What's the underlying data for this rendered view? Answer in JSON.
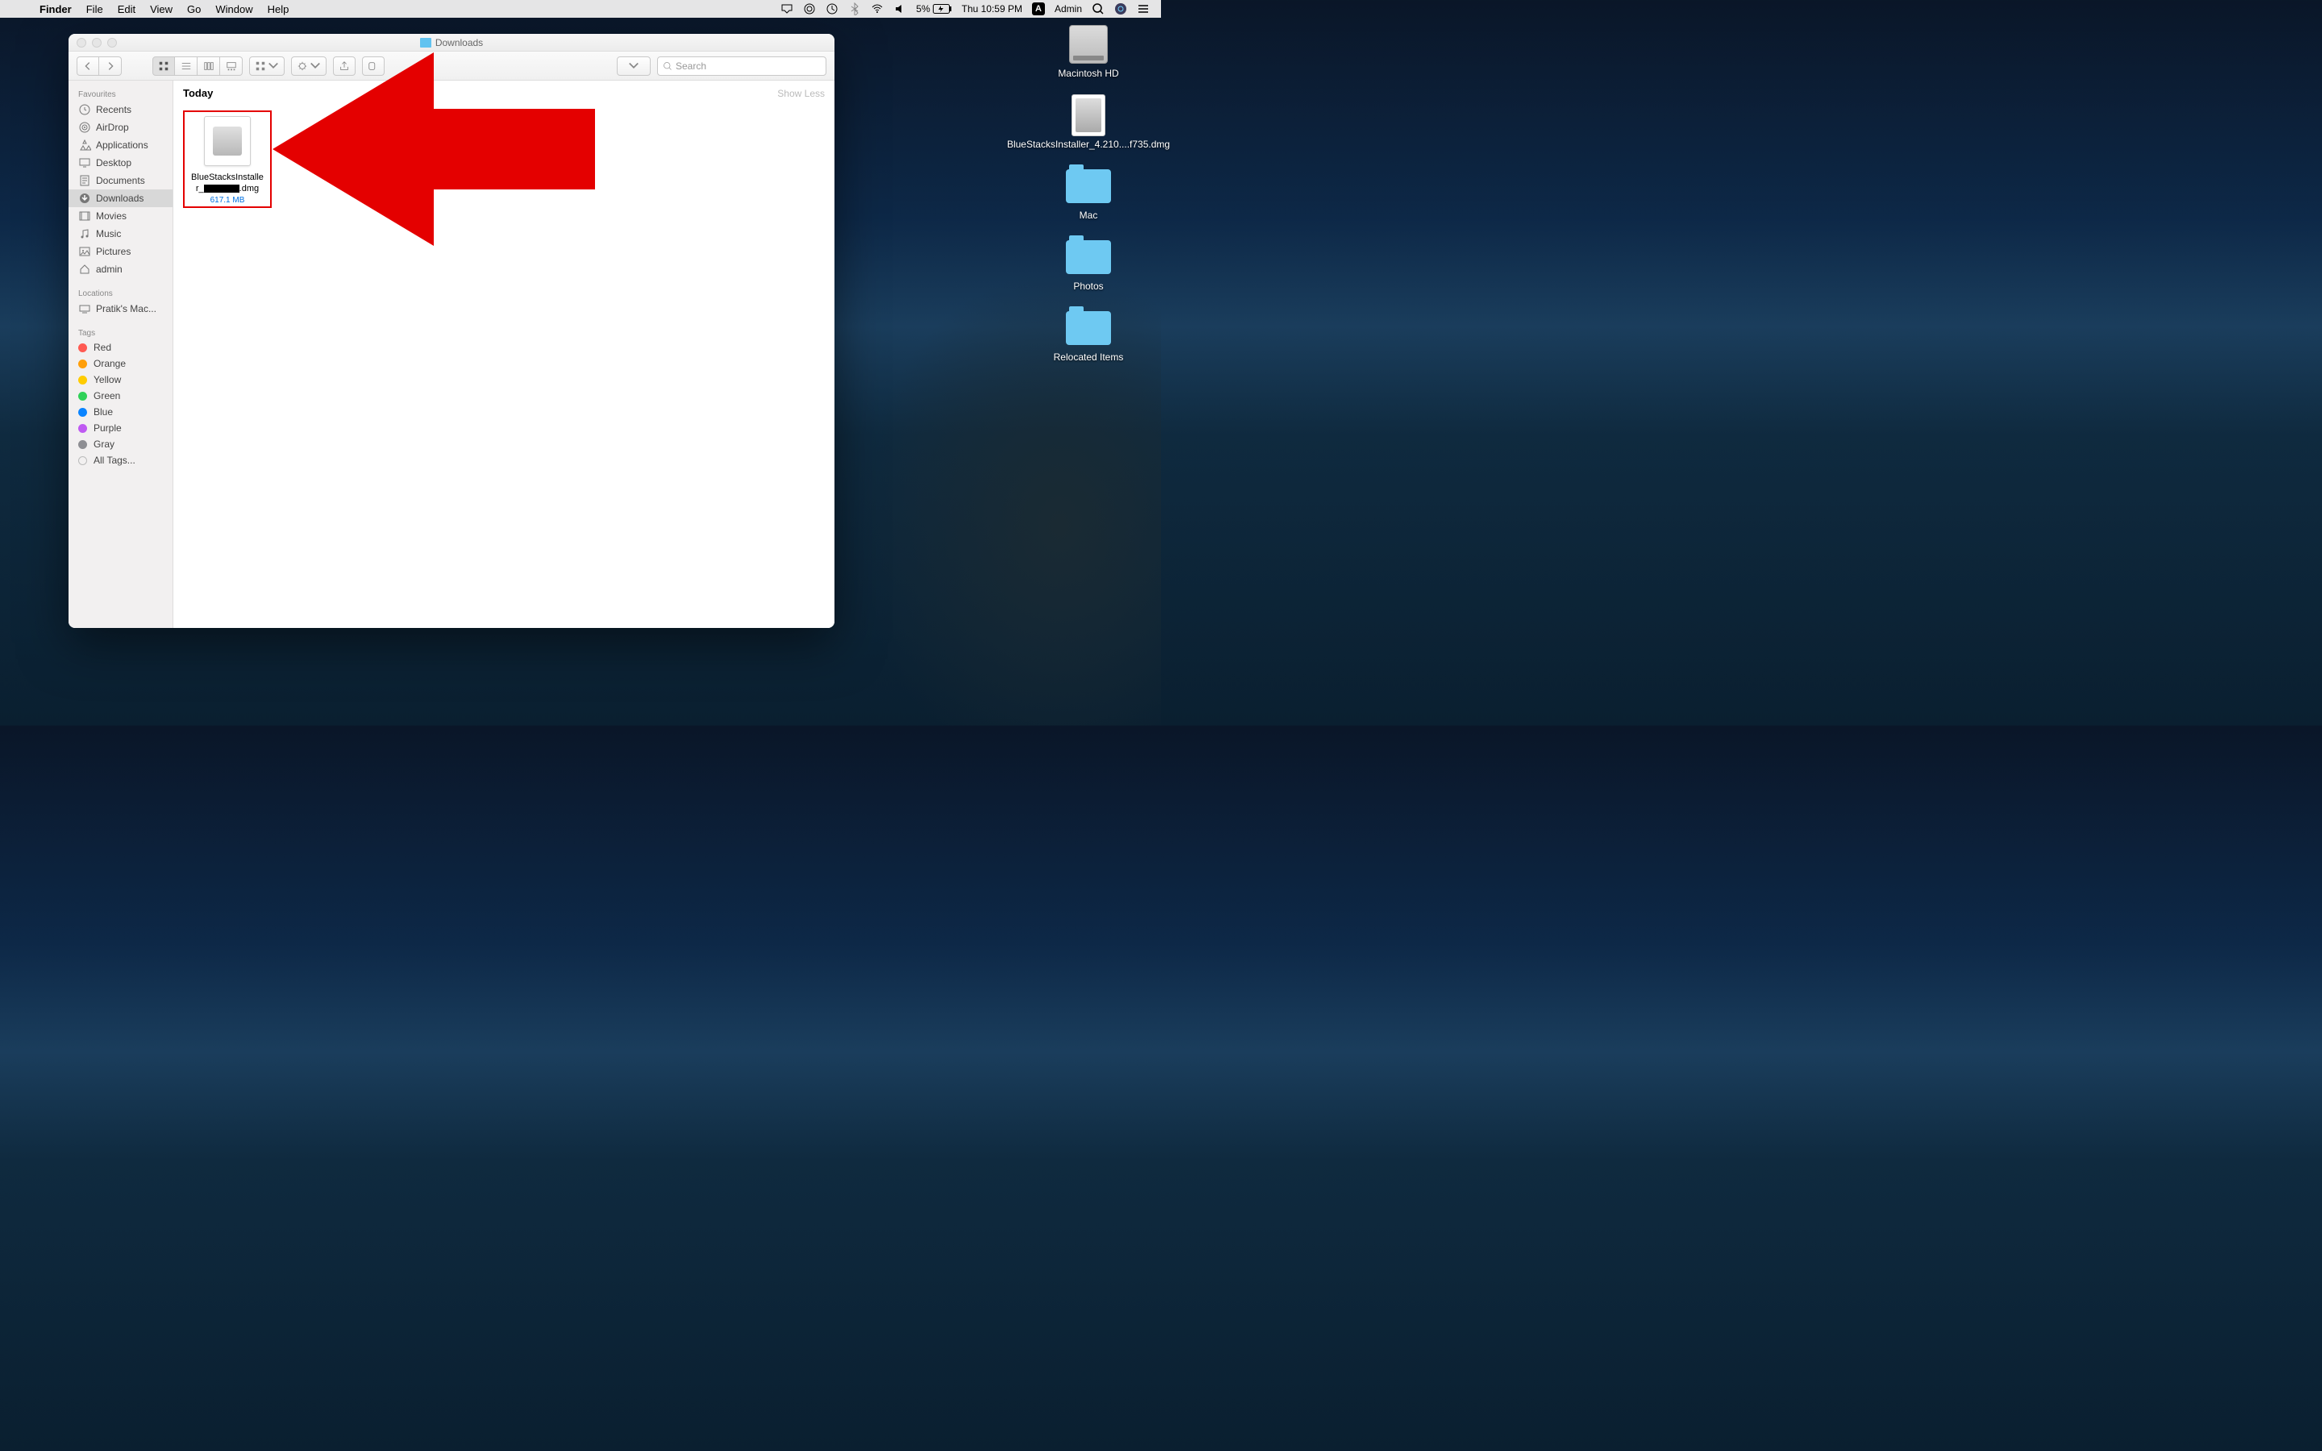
{
  "menubar": {
    "appname": "Finder",
    "menus": [
      "File",
      "Edit",
      "View",
      "Go",
      "Window",
      "Help"
    ],
    "battery_pct": "5%",
    "datetime": "Thu 10:59 PM",
    "user_badge": "A",
    "user": "Admin"
  },
  "desktop": {
    "items": [
      {
        "label": "Macintosh HD",
        "kind": "hd"
      },
      {
        "label": "BlueStacksInstaller_4.210....f735.dmg",
        "kind": "dmg"
      },
      {
        "label": "Mac",
        "kind": "folder"
      },
      {
        "label": "Photos",
        "kind": "folder"
      },
      {
        "label": "Relocated Items",
        "kind": "folder"
      }
    ]
  },
  "finder": {
    "title": "Downloads",
    "search_placeholder": "Search",
    "show_less": "Show Less",
    "groups": [
      {
        "title": "Today",
        "files": [
          {
            "name_line1": "BlueStacksInstalle",
            "name_prefix_line2": "r_",
            "name_suffix_line2": ".dmg",
            "size": "617.1 MB"
          }
        ]
      }
    ],
    "sidebar": {
      "sections": [
        {
          "header": "Favourites",
          "items": [
            {
              "label": "Recents",
              "icon": "clock"
            },
            {
              "label": "AirDrop",
              "icon": "airdrop"
            },
            {
              "label": "Applications",
              "icon": "apps"
            },
            {
              "label": "Desktop",
              "icon": "desktop"
            },
            {
              "label": "Documents",
              "icon": "docs"
            },
            {
              "label": "Downloads",
              "icon": "downloads",
              "selected": true
            },
            {
              "label": "Movies",
              "icon": "movies"
            },
            {
              "label": "Music",
              "icon": "music"
            },
            {
              "label": "Pictures",
              "icon": "pictures"
            },
            {
              "label": "admin",
              "icon": "home"
            }
          ]
        },
        {
          "header": "Locations",
          "items": [
            {
              "label": "Pratik's Mac...",
              "icon": "computer"
            }
          ]
        }
      ],
      "tags_header": "Tags",
      "tags": [
        {
          "label": "Red",
          "color": "#ff5a52"
        },
        {
          "label": "Orange",
          "color": "#ff9f0a"
        },
        {
          "label": "Yellow",
          "color": "#ffcc00"
        },
        {
          "label": "Green",
          "color": "#30d158"
        },
        {
          "label": "Blue",
          "color": "#0a84ff"
        },
        {
          "label": "Purple",
          "color": "#bf5af2"
        },
        {
          "label": "Gray",
          "color": "#8e8e93"
        }
      ],
      "all_tags": "All Tags..."
    }
  }
}
